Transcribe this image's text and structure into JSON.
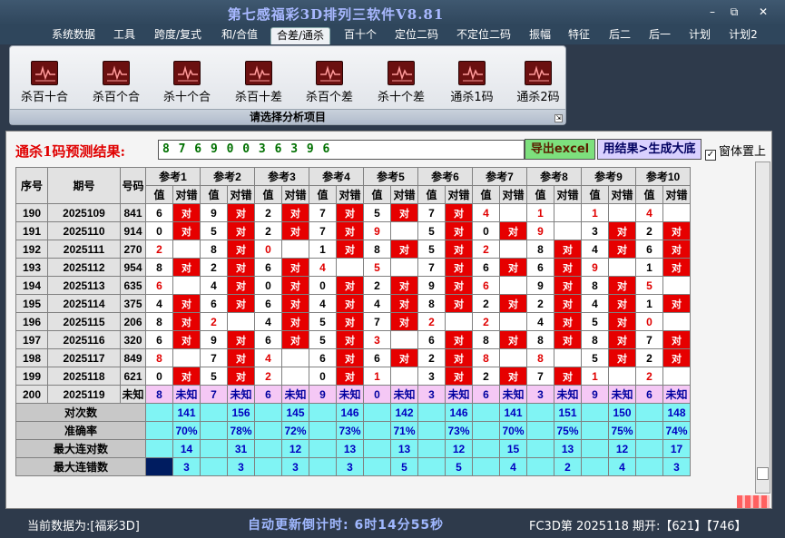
{
  "window": {
    "title": "第七感福彩3D排列三软件V8.81",
    "min": "–",
    "restore": "⧉",
    "close": "✕"
  },
  "menu": [
    "系统数据",
    "工具",
    "跨度/复式",
    "和/合值",
    "合差/通杀",
    "百十个",
    "定位二码",
    "不定位二码",
    "振幅",
    "特征",
    "后二",
    "后一",
    "计划",
    "计划2"
  ],
  "ribbon": {
    "buttons": [
      "杀百十合",
      "杀百个合",
      "杀十个合",
      "杀百十差",
      "杀百个差",
      "杀十个差",
      "通杀1码",
      "通杀2码"
    ],
    "caption": "请选择分析项目",
    "corner": "⇲"
  },
  "prediction": {
    "label": "通杀1码预测结果:",
    "value": "8 7 6 9 0 0 3 6 3 9 6",
    "export": "导出excel",
    "generate": "用结果>生成大底",
    "ontop_label": "窗体置上",
    "ontop_checked": "✓"
  },
  "table": {
    "h_seq": "序号",
    "h_period": "期号",
    "h_num": "号码",
    "ref_headers": [
      "参考1",
      "参考2",
      "参考3",
      "参考4",
      "参考5",
      "参考6",
      "参考7",
      "参考8",
      "参考9",
      "参考10"
    ],
    "sub_val": "值",
    "sub_ok": "对错",
    "ok": "对",
    "unknown": "未知",
    "rows": [
      {
        "seq": "190",
        "period": "2025109",
        "num": "841",
        "cells": [
          [
            "6",
            1
          ],
          [
            "9",
            1
          ],
          [
            "2",
            1
          ],
          [
            "7",
            1
          ],
          [
            "5",
            1
          ],
          [
            "7",
            1
          ],
          [
            "4",
            2
          ],
          [
            "1",
            2
          ],
          [
            "1",
            2
          ],
          [
            "4",
            2
          ]
        ]
      },
      {
        "seq": "191",
        "period": "2025110",
        "num": "914",
        "cells": [
          [
            "0",
            1
          ],
          [
            "5",
            1
          ],
          [
            "2",
            1
          ],
          [
            "7",
            1
          ],
          [
            "9",
            2
          ],
          [
            "5",
            1
          ],
          [
            "0",
            1
          ],
          [
            "9",
            2
          ],
          [
            "3",
            1
          ],
          [
            "2",
            1
          ]
        ]
      },
      {
        "seq": "192",
        "period": "2025111",
        "num": "270",
        "cells": [
          [
            "2",
            2
          ],
          [
            "8",
            1
          ],
          [
            "0",
            2
          ],
          [
            "1",
            1
          ],
          [
            "8",
            1
          ],
          [
            "5",
            1
          ],
          [
            "2",
            2
          ],
          [
            "8",
            1
          ],
          [
            "4",
            1
          ],
          [
            "6",
            1
          ]
        ]
      },
      {
        "seq": "193",
        "period": "2025112",
        "num": "954",
        "cells": [
          [
            "8",
            1
          ],
          [
            "2",
            1
          ],
          [
            "6",
            1
          ],
          [
            "4",
            2
          ],
          [
            "5",
            2
          ],
          [
            "7",
            1
          ],
          [
            "6",
            1
          ],
          [
            "6",
            1
          ],
          [
            "9",
            2
          ],
          [
            "1",
            1
          ]
        ]
      },
      {
        "seq": "194",
        "period": "2025113",
        "num": "635",
        "cells": [
          [
            "6",
            2
          ],
          [
            "4",
            1
          ],
          [
            "0",
            1
          ],
          [
            "0",
            1
          ],
          [
            "2",
            1
          ],
          [
            "9",
            1
          ],
          [
            "6",
            2
          ],
          [
            "9",
            1
          ],
          [
            "8",
            1
          ],
          [
            "5",
            2
          ]
        ]
      },
      {
        "seq": "195",
        "period": "2025114",
        "num": "375",
        "cells": [
          [
            "4",
            1
          ],
          [
            "6",
            1
          ],
          [
            "6",
            1
          ],
          [
            "4",
            1
          ],
          [
            "4",
            1
          ],
          [
            "8",
            1
          ],
          [
            "2",
            1
          ],
          [
            "2",
            1
          ],
          [
            "4",
            1
          ],
          [
            "1",
            1
          ]
        ]
      },
      {
        "seq": "196",
        "period": "2025115",
        "num": "206",
        "cells": [
          [
            "8",
            1
          ],
          [
            "2",
            2
          ],
          [
            "4",
            1
          ],
          [
            "5",
            1
          ],
          [
            "7",
            1
          ],
          [
            "2",
            2
          ],
          [
            "2",
            2
          ],
          [
            "4",
            1
          ],
          [
            "5",
            1
          ],
          [
            "0",
            2
          ]
        ]
      },
      {
        "seq": "197",
        "period": "2025116",
        "num": "320",
        "cells": [
          [
            "6",
            1
          ],
          [
            "9",
            1
          ],
          [
            "6",
            1
          ],
          [
            "5",
            1
          ],
          [
            "3",
            2
          ],
          [
            "6",
            1
          ],
          [
            "8",
            1
          ],
          [
            "8",
            1
          ],
          [
            "8",
            1
          ],
          [
            "7",
            1
          ]
        ]
      },
      {
        "seq": "198",
        "period": "2025117",
        "num": "849",
        "cells": [
          [
            "8",
            2
          ],
          [
            "7",
            1
          ],
          [
            "4",
            2
          ],
          [
            "6",
            1
          ],
          [
            "6",
            1
          ],
          [
            "2",
            1
          ],
          [
            "8",
            2
          ],
          [
            "8",
            2
          ],
          [
            "5",
            1
          ],
          [
            "2",
            1
          ]
        ]
      },
      {
        "seq": "199",
        "period": "2025118",
        "num": "621",
        "cells": [
          [
            "0",
            1
          ],
          [
            "5",
            1
          ],
          [
            "2",
            2
          ],
          [
            "0",
            1
          ],
          [
            "1",
            2
          ],
          [
            "3",
            1
          ],
          [
            "2",
            1
          ],
          [
            "7",
            1
          ],
          [
            "1",
            2
          ],
          [
            "2",
            2
          ]
        ]
      }
    ],
    "last_row": {
      "seq": "200",
      "period": "2025119",
      "num": "未知",
      "values": [
        "8",
        "7",
        "6",
        "9",
        "0",
        "3",
        "6",
        "3",
        "9",
        "6"
      ]
    },
    "stats": [
      {
        "label": "对次数",
        "values": [
          "141",
          "156",
          "145",
          "146",
          "142",
          "146",
          "141",
          "151",
          "150",
          "148"
        ]
      },
      {
        "label": "准确率",
        "values": [
          "70%",
          "78%",
          "72%",
          "73%",
          "71%",
          "73%",
          "70%",
          "75%",
          "75%",
          "74%"
        ]
      },
      {
        "label": "最大连对数",
        "values": [
          "14",
          "31",
          "12",
          "13",
          "13",
          "12",
          "15",
          "13",
          "12",
          "17"
        ]
      },
      {
        "label": "最大连错数",
        "values": [
          "3",
          "3",
          "3",
          "3",
          "5",
          "5",
          "4",
          "2",
          "4",
          "3"
        ]
      }
    ]
  },
  "status": {
    "left": "当前数据为:[福彩3D]",
    "countdown": "自动更新倒计时: 6时14分55秒",
    "right": "FC3D第 2025118 期开:【621】【746】"
  },
  "colors": {
    "bg": "#2e3a4b",
    "ok_red": "#e60000",
    "stat_cyan": "#80f4f4",
    "unknown_pink": "#f5c8f5"
  }
}
